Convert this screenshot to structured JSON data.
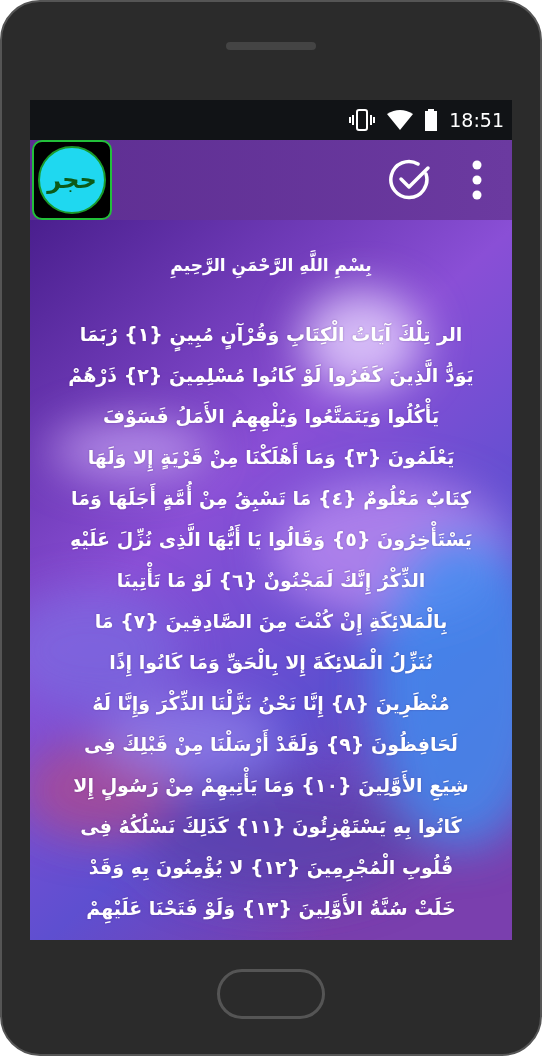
{
  "status_bar": {
    "time": "18:51"
  },
  "app_bar": {
    "logo_text": "حجر"
  },
  "content": {
    "kind": "picture",
    "heading": "بِسْمِ اللَّهِ الرَّحْمَنِ الرَّحِيمِ",
    "lines": [
      "الر تِلْكَ آيَاتُ الْكِتَابِ وَقُرْآنٍ مُبِينٍ {١} رُبَمَا",
      "يَوَدُّ الَّذِينَ كَفَرُوا لَوْ كَانُوا مُسْلِمِينَ {٢} ذَرْهُمْ",
      "يَأْكُلُوا وَيَتَمَتَّعُوا وَيُلْهِهِمُ الأَمَلُ فَسَوْفَ",
      "يَعْلَمُونَ {٣} وَمَا أَهْلَكْنَا مِنْ قَرْيَةٍ إِلا وَلَهَا",
      "كِتَابٌ مَعْلُومٌ {٤} مَا تَسْبِقُ مِنْ أُمَّةٍ أَجَلَهَا وَمَا",
      "يَسْتَأْخِرُونَ {٥} وَقَالُوا يَا أَيُّهَا الَّذِى نُزِّلَ عَلَيْهِ",
      "الذِّكْرُ إِنَّكَ لَمَجْنُونٌ {٦} لَوْ مَا تَأْتِينَا",
      "بِالْمَلائِكَةِ إِنْ كُنْتَ مِنَ الصَّادِقِينَ {٧} مَا",
      "نُنَزِّلُ الْمَلائِكَةَ إِلا بِالْحَقِّ وَمَا كَانُوا إِذًا",
      "مُنْظَرِينَ {٨} إِنَّا نَحْنُ نَزَّلْنَا الذِّكْرَ وَإِنَّا لَهُ",
      "لَحَافِظُونَ {٩} وَلَقَدْ أَرْسَلْنَا مِنْ قَبْلِكَ فِى",
      "شِيَعِ الأَوَّلِينَ {١٠} وَمَا يَأْتِيهِمْ مِنْ رَسُولٍ إِلا",
      "كَانُوا بِهِ يَسْتَهْزِئُونَ {١١} كَذَلِكَ نَسْلُكُهُ فِى",
      "قُلُوبِ الْمُجْرِمِينَ {١٢} لا يُؤْمِنُونَ بِهِ وَقَدْ",
      "خَلَتْ سُنَّةُ الأَوَّلِينَ {١٣} وَلَوْ فَتَحْنَا عَلَيْهِمْ"
    ]
  }
}
